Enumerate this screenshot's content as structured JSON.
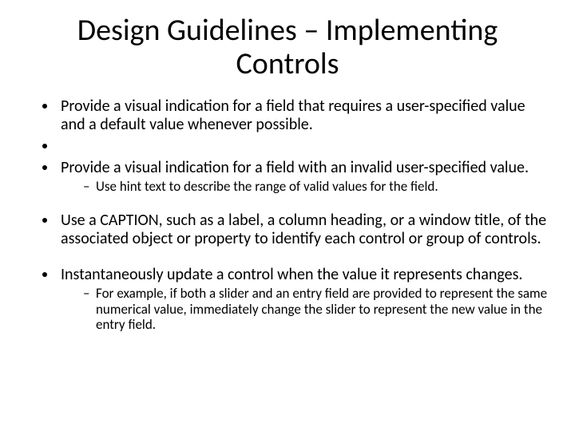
{
  "title": "Design Guidelines – Implementing Controls",
  "bullets": {
    "b1": "Provide a visual indication for a field that requires a user-specified value and a default value whenever possible.",
    "b2": "",
    "b3": "Provide a visual indication for a field with an invalid user-specified value.",
    "b3_sub1": "Use hint text to describe the range of valid values for the field.",
    "b4": "Use a CAPTION, such as a label, a column heading, or a window title, of the associated object or property to identify each control or group of controls.",
    "b5": "Instantaneously update a control when the value it represents changes.",
    "b5_sub1": "For example, if both a slider and an entry field are provided to represent the same numerical value, immediately change the slider to represent the new value in the entry field."
  }
}
